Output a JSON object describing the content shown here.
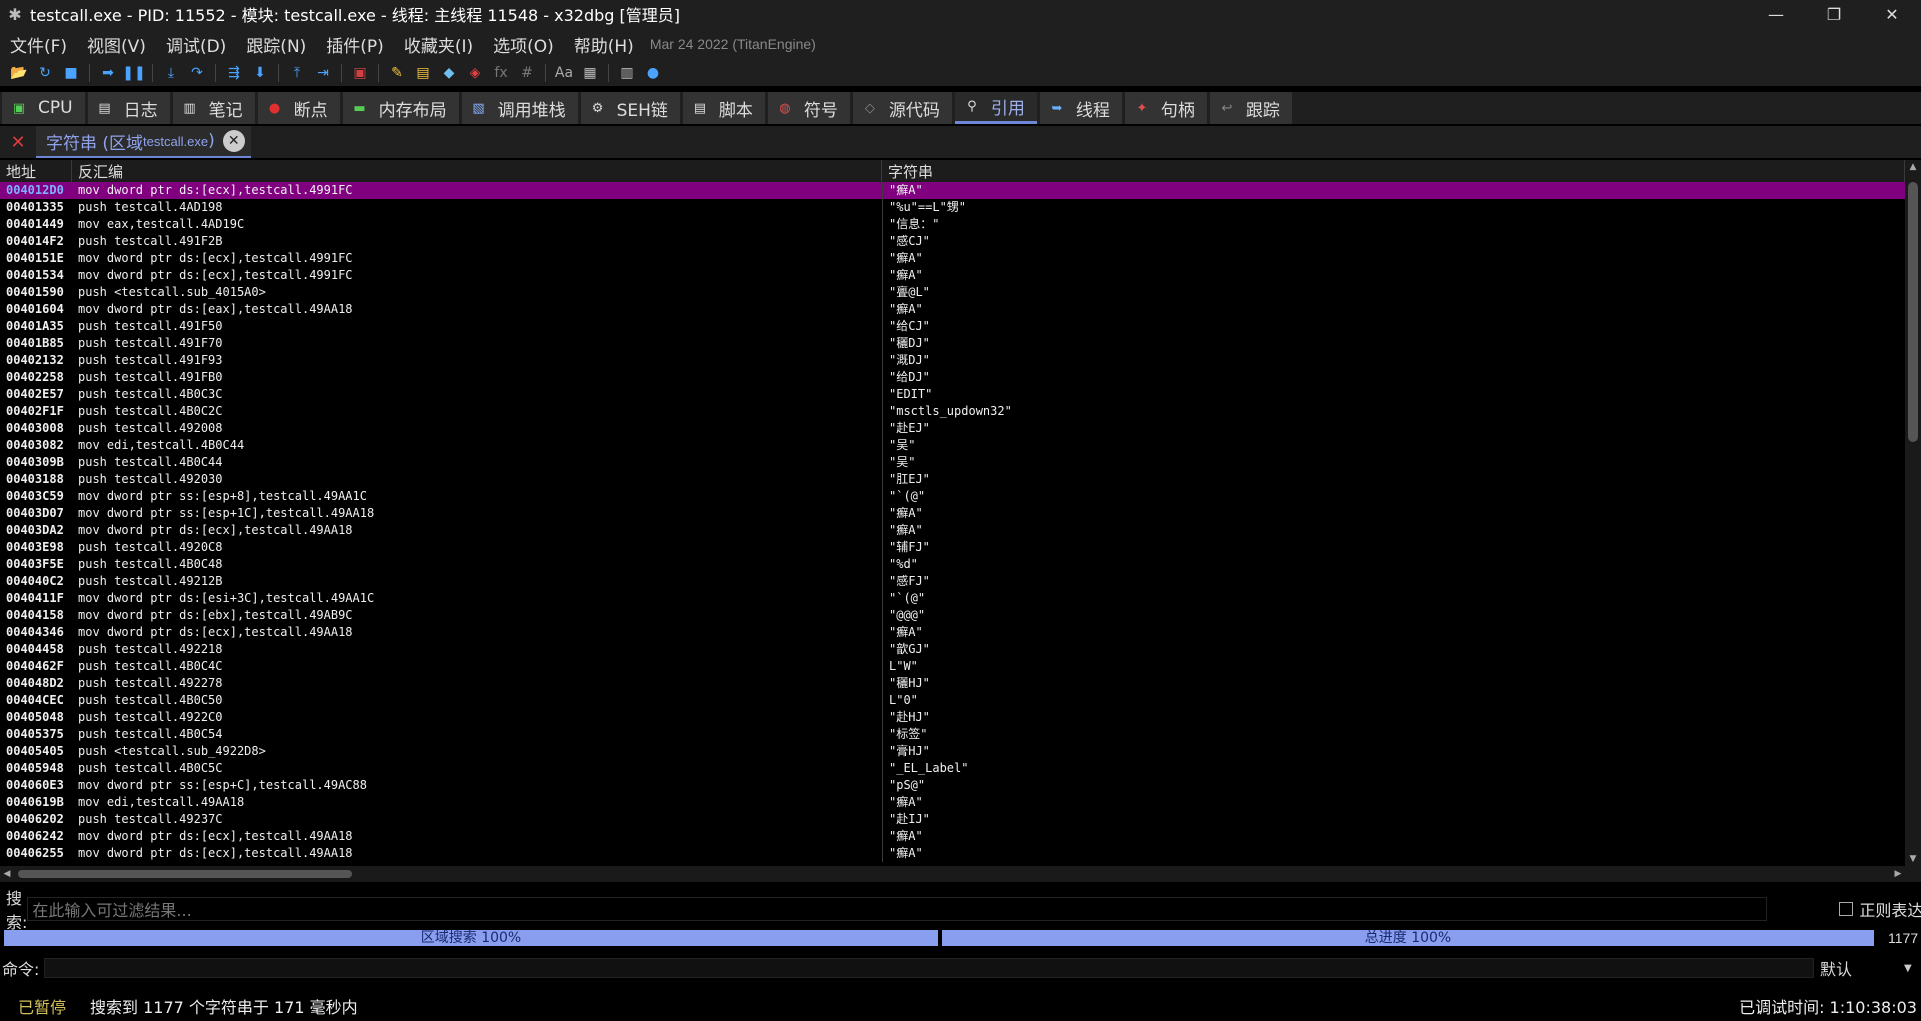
{
  "window": {
    "title": "testcall.exe - PID: 11552 - 模块: testcall.exe - 线程: 主线程 11548 - x32dbg [管理员]",
    "minimize": "—",
    "maximize": "❐",
    "close": "✕"
  },
  "menu": {
    "items": [
      "文件(F)",
      "视图(V)",
      "调试(D)",
      "跟踪(N)",
      "插件(P)",
      "收藏夹(I)",
      "选项(O)",
      "帮助(H)"
    ],
    "build_date": "Mar 24 2022 (TitanEngine)"
  },
  "toolbar": {
    "icons": [
      {
        "name": "open-icon",
        "glyph": "📂",
        "color": "#e0b040"
      },
      {
        "name": "restart-icon",
        "glyph": "↻",
        "color": "#4aa3ff"
      },
      {
        "name": "stop-icon",
        "glyph": "■",
        "color": "#4aa3ff"
      },
      {
        "name": "sep"
      },
      {
        "name": "run-icon",
        "glyph": "➡",
        "color": "#4aa3ff"
      },
      {
        "name": "pause-icon",
        "glyph": "❚❚",
        "color": "#4aa3ff"
      },
      {
        "name": "sep"
      },
      {
        "name": "step-into-icon",
        "glyph": "⤓",
        "color": "#4aa3ff"
      },
      {
        "name": "step-over-icon",
        "glyph": "↷",
        "color": "#4aa3ff"
      },
      {
        "name": "sep"
      },
      {
        "name": "trace-into-icon",
        "glyph": "⇶",
        "color": "#4aa3ff"
      },
      {
        "name": "trace-over-icon",
        "glyph": "⬇",
        "color": "#4aa3ff"
      },
      {
        "name": "sep"
      },
      {
        "name": "run-to-user-icon",
        "glyph": "⤒",
        "color": "#4aa3ff"
      },
      {
        "name": "execute-till-return-icon",
        "glyph": "⇥",
        "color": "#4aa3ff"
      },
      {
        "name": "sep"
      },
      {
        "name": "stop-trace-icon",
        "glyph": "▣",
        "color": "#d04040"
      },
      {
        "name": "sep"
      },
      {
        "name": "patch-icon",
        "glyph": "✎",
        "color": "#f0c040"
      },
      {
        "name": "memory-icon",
        "glyph": "▤",
        "color": "#f0c040"
      },
      {
        "name": "scylla-icon",
        "glyph": "◆",
        "color": "#6ec0f0"
      },
      {
        "name": "breakpoint-remove-icon",
        "glyph": "◈",
        "color": "#e04040"
      },
      {
        "name": "function-icon",
        "glyph": "fx",
        "color": "#777"
      },
      {
        "name": "hash-icon",
        "glyph": "#",
        "color": "#777"
      },
      {
        "name": "sep"
      },
      {
        "name": "font-icon",
        "glyph": "Aa",
        "color": "#aaa"
      },
      {
        "name": "calculator-icon",
        "glyph": "▦",
        "color": "#bbb"
      },
      {
        "name": "sep"
      },
      {
        "name": "notes-icon",
        "glyph": "▥",
        "color": "#bbb"
      },
      {
        "name": "globe-icon",
        "glyph": "●",
        "color": "#4aa3ff"
      }
    ]
  },
  "tabs": [
    {
      "label": "CPU",
      "icon": "cpu-icon",
      "glyph": "▣",
      "color": "#5c5",
      "active": false
    },
    {
      "label": "日志",
      "icon": "log-icon",
      "glyph": "▤",
      "color": "#ddd",
      "active": false
    },
    {
      "label": "笔记",
      "icon": "notes-icon",
      "glyph": "▥",
      "color": "#ddd",
      "active": false
    },
    {
      "label": "断点",
      "icon": "breakpoint-icon",
      "glyph": "●",
      "color": "#e03030",
      "active": false
    },
    {
      "label": "内存布局",
      "icon": "memory-map-icon",
      "glyph": "▬",
      "color": "#5c5",
      "active": false
    },
    {
      "label": "调用堆栈",
      "icon": "callstack-icon",
      "glyph": "▧",
      "color": "#8ab0ff",
      "active": false
    },
    {
      "label": "SEH链",
      "icon": "seh-icon",
      "glyph": "⚙",
      "color": "#ddd",
      "active": false
    },
    {
      "label": "脚本",
      "icon": "script-icon",
      "glyph": "▤",
      "color": "#ddd",
      "active": false
    },
    {
      "label": "符号",
      "icon": "symbols-icon",
      "glyph": "◍",
      "color": "#e05050",
      "active": false
    },
    {
      "label": "源代码",
      "icon": "source-icon",
      "glyph": "◇",
      "color": "#888",
      "active": false
    },
    {
      "label": "引用",
      "icon": "references-icon",
      "glyph": "⚲",
      "color": "#ddd",
      "active": true
    },
    {
      "label": "线程",
      "icon": "threads-icon",
      "glyph": "➥",
      "color": "#6ab0ff",
      "active": false
    },
    {
      "label": "句柄",
      "icon": "handles-icon",
      "glyph": "✦",
      "color": "#e05050",
      "active": false
    },
    {
      "label": "跟踪",
      "icon": "trace-icon",
      "glyph": "↩",
      "color": "#888",
      "active": false
    }
  ],
  "subtab": {
    "label": "字符串 (区域 ",
    "module": "testcall.exe",
    "suffix": ")",
    "close_glyph": "✕",
    "closeall_glyph": "✕"
  },
  "table": {
    "columns": [
      "地址",
      "反汇编",
      "字符串"
    ],
    "selected_index": 0,
    "rows": [
      [
        "004012D0",
        "mov dword ptr ds:[ecx],testcall.4991FC",
        "\"癬A\""
      ],
      [
        "00401335",
        "push testcall.4AD198",
        "\"%u\"==L\"甥\""
      ],
      [
        "00401449",
        "mov eax,testcall.4AD19C",
        "\"信息：\""
      ],
      [
        "004014F2",
        "push testcall.491F2B",
        "\"感CJ\""
      ],
      [
        "0040151E",
        "mov dword ptr ds:[ecx],testcall.4991FC",
        "\"癬A\""
      ],
      [
        "00401534",
        "mov dword ptr ds:[ecx],testcall.4991FC",
        "\"癬A\""
      ],
      [
        "00401590",
        "push <testcall.sub_4015A0>",
        "\"亹@L\""
      ],
      [
        "00401604",
        "mov dword ptr ds:[eax],testcall.49AA18",
        "\"癬A\""
      ],
      [
        "00401A35",
        "push testcall.491F50",
        "\"给CJ\""
      ],
      [
        "00401B85",
        "push testcall.491F70",
        "\"穲DJ\""
      ],
      [
        "00402132",
        "push testcall.491F93",
        "\"溉DJ\""
      ],
      [
        "00402258",
        "push testcall.491FB0",
        "\"给DJ\""
      ],
      [
        "00402E57",
        "push testcall.4B0C3C",
        "\"EDIT\""
      ],
      [
        "00402F1F",
        "push testcall.4B0C2C",
        "\"msctls_updown32\""
      ],
      [
        "00403008",
        "push testcall.492008",
        "\"赴EJ\""
      ],
      [
        "00403082",
        "mov edi,testcall.4B0C44",
        "\"吴\""
      ],
      [
        "0040309B",
        "push testcall.4B0C44",
        "\"吴\""
      ],
      [
        "00403188",
        "push testcall.492030",
        "\"肛EJ\""
      ],
      [
        "00403C59",
        "mov dword ptr ss:[esp+8],testcall.49AA1C",
        "\"`(@\""
      ],
      [
        "00403D07",
        "mov dword ptr ss:[esp+1C],testcall.49AA18",
        "\"癬A\""
      ],
      [
        "00403DA2",
        "mov dword ptr ds:[ecx],testcall.49AA18",
        "\"癬A\""
      ],
      [
        "00403E98",
        "push testcall.4920C8",
        "\"辅FJ\""
      ],
      [
        "00403F5E",
        "push testcall.4B0C48",
        "\"%d\""
      ],
      [
        "004040C2",
        "push testcall.49212B",
        "\"感FJ\""
      ],
      [
        "0040411F",
        "mov dword ptr ds:[esi+3C],testcall.49AA1C",
        "\"`(@\""
      ],
      [
        "00404158",
        "mov dword ptr ds:[ebx],testcall.49AB9C",
        "\"@@@\""
      ],
      [
        "00404346",
        "mov dword ptr ds:[ecx],testcall.49AA18",
        "\"癬A\""
      ],
      [
        "00404458",
        "push testcall.492218",
        "\"歆GJ\""
      ],
      [
        "0040462F",
        "push testcall.4B0C4C",
        "L\"W\""
      ],
      [
        "004048D2",
        "push testcall.492278",
        "\"穲HJ\""
      ],
      [
        "00404CEC",
        "push testcall.4B0C50",
        "L\"0\""
      ],
      [
        "00405048",
        "push testcall.4922C0",
        "\"赴HJ\""
      ],
      [
        "00405375",
        "push testcall.4B0C54",
        "\"标签\""
      ],
      [
        "00405405",
        "push <testcall.sub_4922D8>",
        "\"膏HJ\""
      ],
      [
        "00405948",
        "push testcall.4B0C5C",
        "\"_EL_Label\""
      ],
      [
        "004060E3",
        "mov dword ptr ss:[esp+C],testcall.49AC88",
        "\"pS@\""
      ],
      [
        "0040619B",
        "mov edi,testcall.49AA18",
        "\"癬A\""
      ],
      [
        "00406202",
        "push testcall.49237C",
        "\"赴IJ\""
      ],
      [
        "00406242",
        "mov dword ptr ds:[ecx],testcall.49AA18",
        "\"癬A\""
      ],
      [
        "00406255",
        "mov dword ptr ds:[ecx],testcall.49AA18",
        "\"癬A\""
      ]
    ]
  },
  "search": {
    "label": "搜索:",
    "placeholder": "在此输入可过滤结果...",
    "regex_label": "正则表达式"
  },
  "progress": {
    "region_label": "区域搜索 100%",
    "region_value": 1.0,
    "total_label": "总进度 100%",
    "total_value": 1.0,
    "count": "1177"
  },
  "command": {
    "label": "命令:",
    "mode": "默认"
  },
  "status": {
    "state": "已暂停",
    "message": "搜索到 1177 个字符串于 171 毫秒内",
    "elapsed": "已调试时间: 1:10:38:03"
  }
}
